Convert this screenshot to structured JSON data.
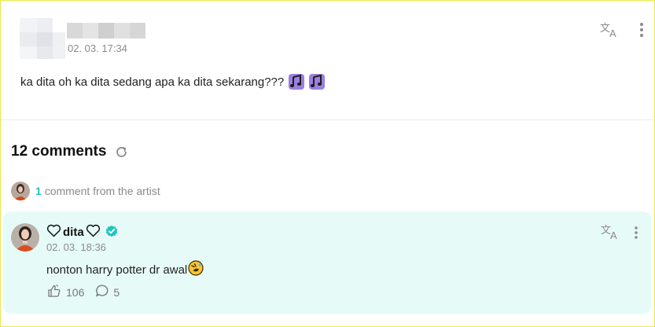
{
  "post": {
    "timestamp": "02. 03. 17:34",
    "text": "ka dita oh ka dita sedang apa ka dita sekarang???",
    "emojis": [
      "musical-notes-emoji",
      "musical-notes-emoji"
    ],
    "translate_icon": "translate-icon",
    "more_icon": "more-vertical-icon"
  },
  "comments": {
    "title": "12 comments",
    "refresh_icon": "refresh-icon",
    "artist_count": "1",
    "artist_label": "comment from the artist"
  },
  "artist_comment": {
    "author": "dita",
    "verified_icon": "verified-badge-icon",
    "timestamp": "02. 03. 18:36",
    "text": "nonton harry potter dr awal",
    "emoji": "rolling-laughing-emoji",
    "likes": "106",
    "replies": "5"
  },
  "colors": {
    "accent": "#1fc4c4",
    "card_bg": "#e6fbf7",
    "emoji_purple": "#9b7fe0",
    "verified": "#22c3c3"
  }
}
